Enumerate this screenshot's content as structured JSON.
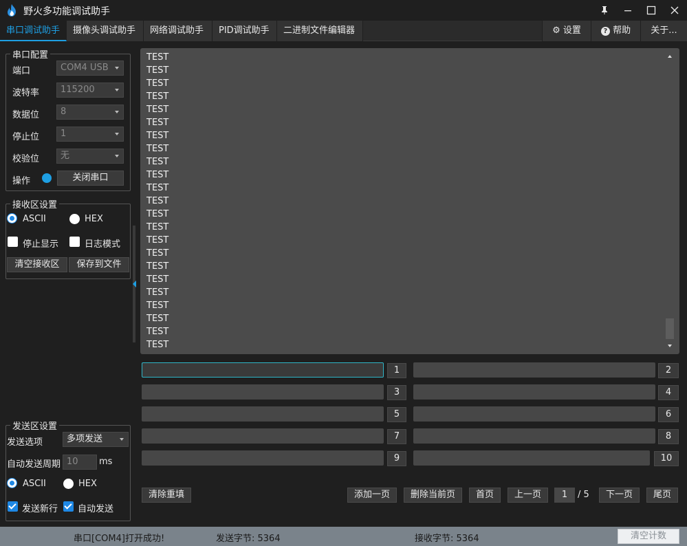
{
  "app": {
    "title": "野火多功能调试助手"
  },
  "tabs": [
    {
      "label": "串口调试助手",
      "active": true
    },
    {
      "label": "摄像头调试助手"
    },
    {
      "label": "网络调试助手"
    },
    {
      "label": "PID调试助手"
    },
    {
      "label": "二进制文件编辑器"
    }
  ],
  "right_tabs": {
    "settings": "设置",
    "help": "帮助",
    "about": "关于..."
  },
  "serial_config": {
    "title": "串口配置",
    "port_label": "端口",
    "port_value": "COM4 USB",
    "baud_label": "波特率",
    "baud_value": "115200",
    "databits_label": "数据位",
    "databits_value": "8",
    "stopbits_label": "停止位",
    "stopbits_value": "1",
    "parity_label": "校验位",
    "parity_value": "无",
    "op_label": "操作",
    "close_button": "关闭串口"
  },
  "receive_settings": {
    "title": "接收区设置",
    "ascii": "ASCII",
    "hex": "HEX",
    "stop_display": "停止显示",
    "log_mode": "日志模式",
    "clear_button": "清空接收区",
    "save_button": "保存到文件"
  },
  "send_settings": {
    "title": "发送区设置",
    "option_label": "发送选项",
    "option_value": "多项发送",
    "period_label": "自动发送周期",
    "period_value": "10",
    "period_unit": "ms",
    "ascii": "ASCII",
    "hex": "HEX",
    "newline": "发送新行",
    "auto_send": "自动发送"
  },
  "receive_lines": [
    "TEST",
    "TEST",
    "TEST",
    "TEST",
    "TEST",
    "TEST",
    "TEST",
    "TEST",
    "TEST",
    "TEST",
    "TEST",
    "TEST",
    "TEST",
    "TEST",
    "TEST",
    "TEST",
    "TEST",
    "TEST",
    "TEST",
    "TEST",
    "TEST",
    "TEST",
    "TEST"
  ],
  "send_numbers": [
    "1",
    "2",
    "3",
    "4",
    "5",
    "6",
    "7",
    "8",
    "9",
    "10"
  ],
  "bottom": {
    "clear_refill": "清除重填",
    "add_page": "添加一页",
    "delete_page": "删除当前页",
    "first_page": "首页",
    "prev_page": "上一页",
    "page_value": "1",
    "page_total": "/ 5",
    "next_page": "下一页",
    "last_page": "尾页"
  },
  "status": {
    "message": "串口[COM4]打开成功!",
    "sent": "发送字节: 5364",
    "received": "接收字节: 5364",
    "clear_count": "清空计数"
  },
  "colors": {
    "accent": "#1e9fe3",
    "status_bar": "#7a838b"
  }
}
